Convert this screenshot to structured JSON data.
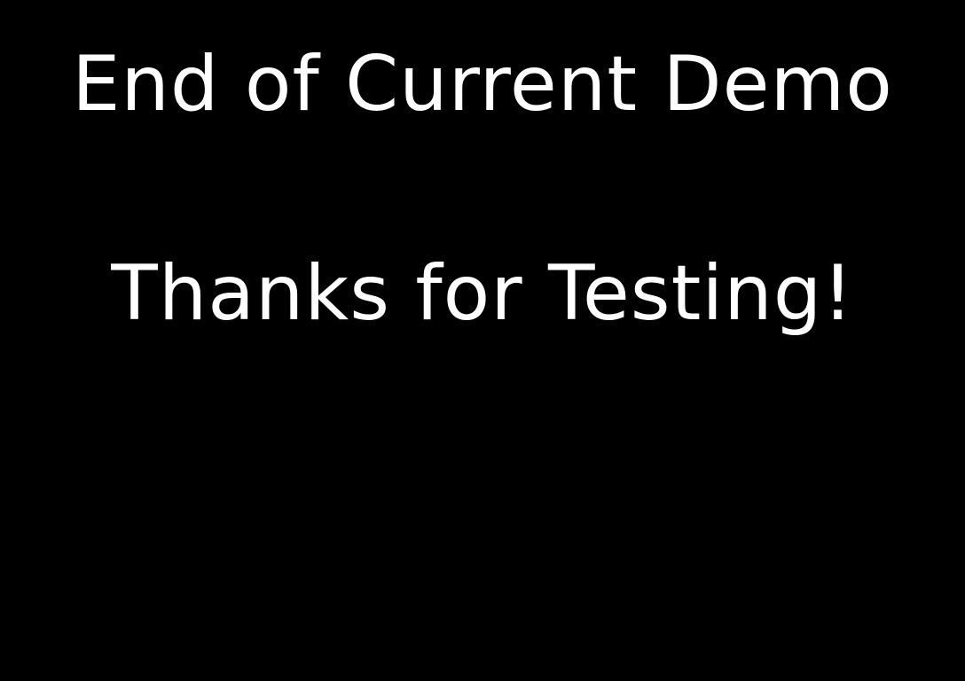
{
  "screen": {
    "title": "End of Current Demo",
    "message": "Thanks for Testing!",
    "background_color": "#000000",
    "text_color": "#ffffff"
  }
}
